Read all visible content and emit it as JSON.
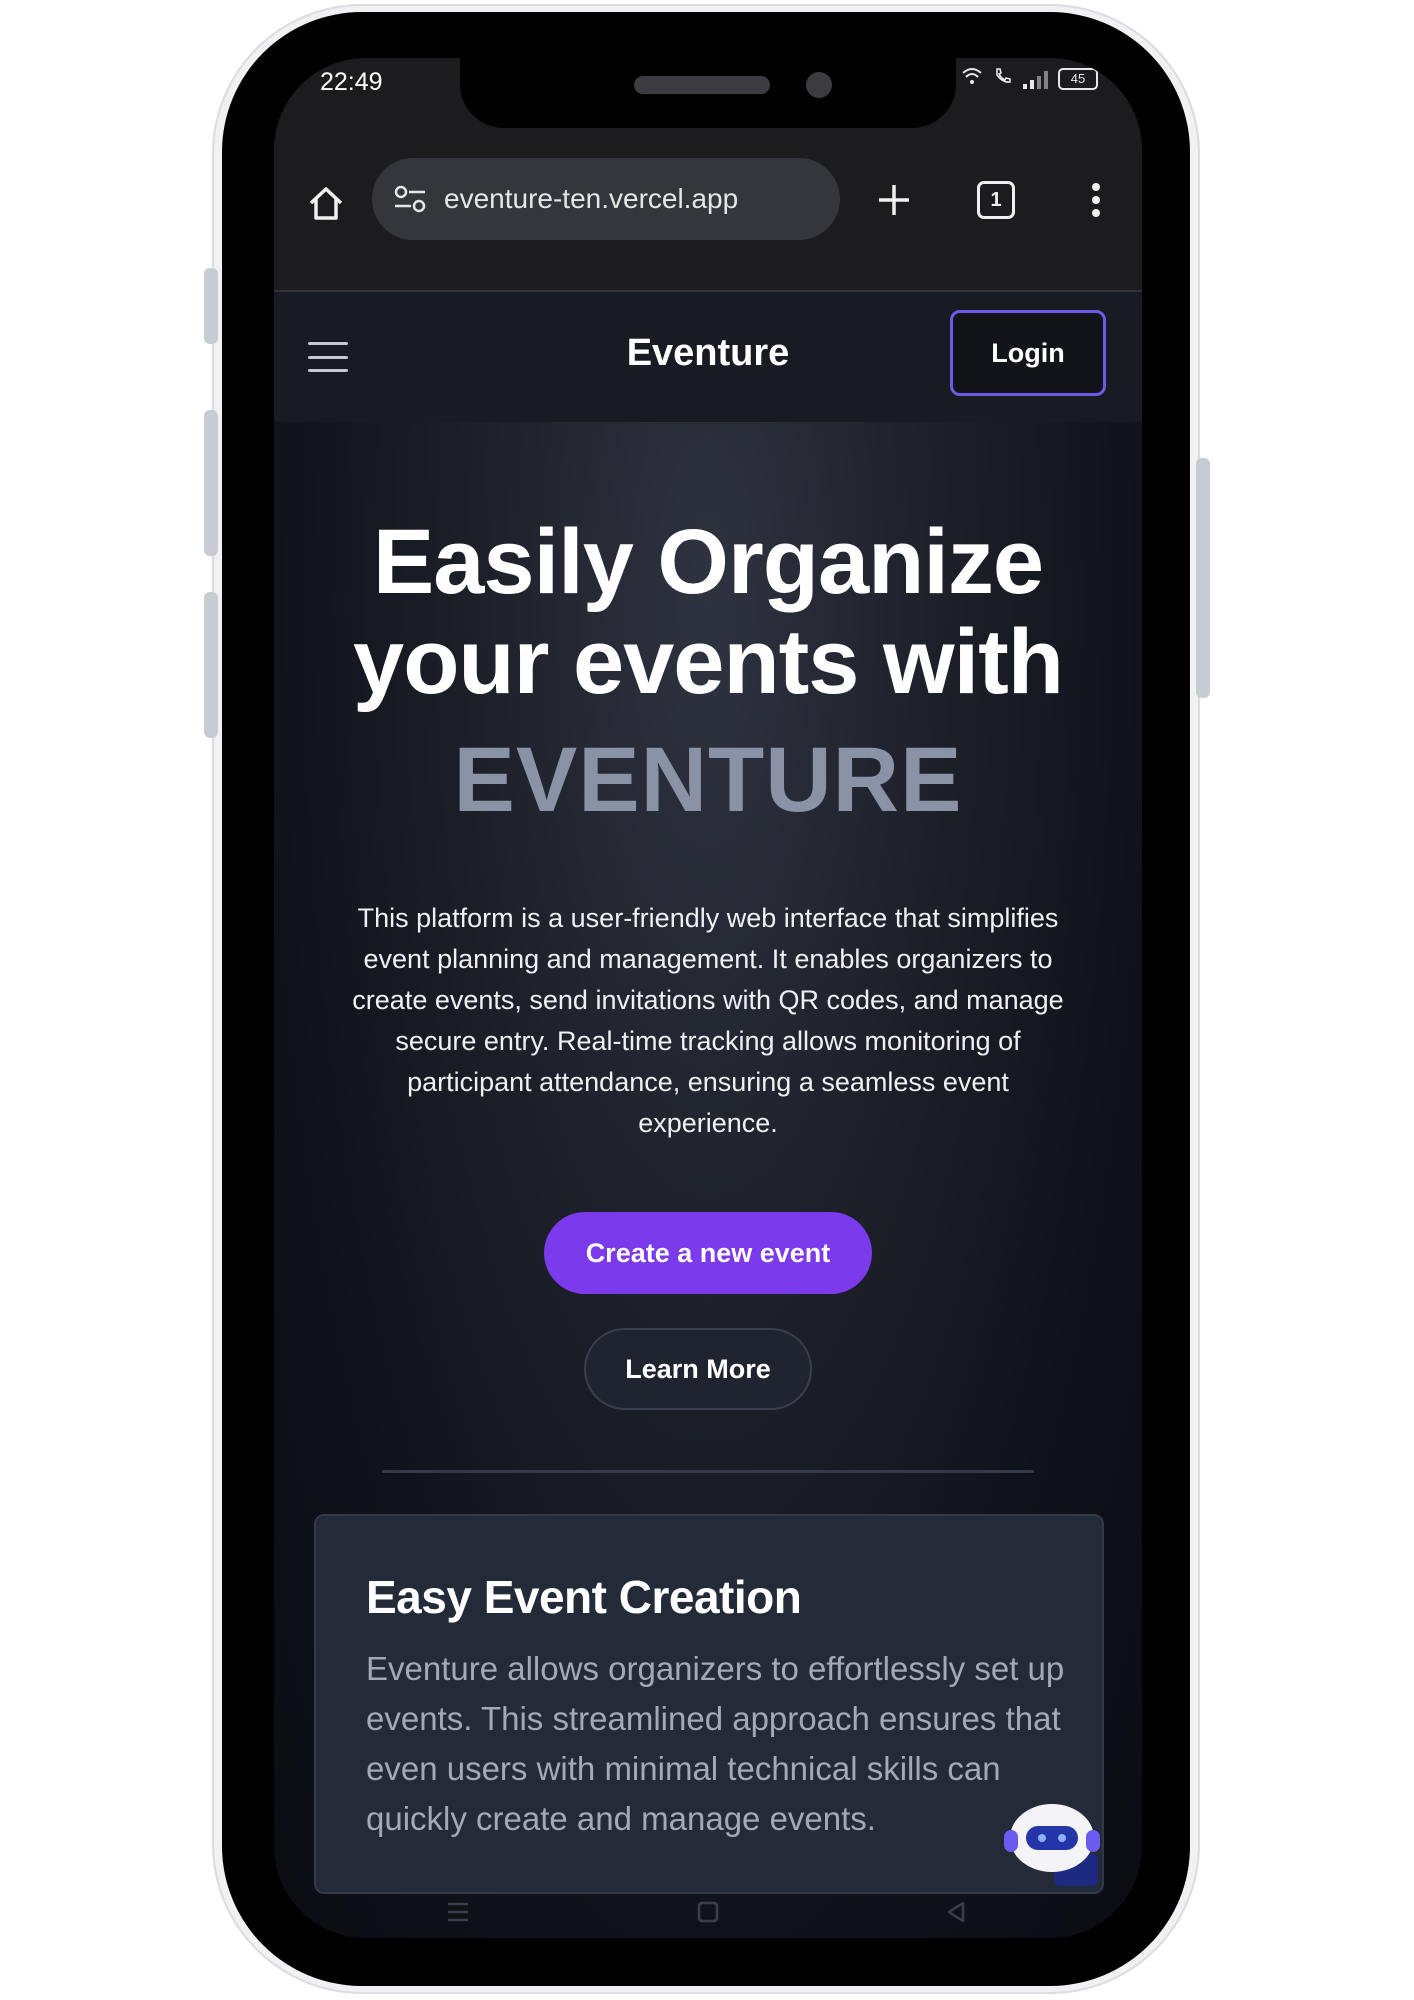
{
  "status_bar": {
    "time": "22:49",
    "battery": "45"
  },
  "browser": {
    "url": "eventure-ten.vercel.app",
    "tab_count": "1"
  },
  "site_nav": {
    "brand": "Eventure",
    "login_label": "Login"
  },
  "hero": {
    "title_line1": "Easily Organize",
    "title_line2": "your events with",
    "title_brand": "EVENTURE",
    "description": "This platform is a user-friendly web interface that simplifies event planning and management. It enables organizers to create events, send invitations with QR codes, and manage secure entry. Real-time tracking allows monitoring of participant attendance, ensuring a seamless event experience.",
    "primary_cta": "Create a new event",
    "secondary_cta": "Learn More"
  },
  "feature": {
    "title": "Easy Event Creation",
    "text": "Eventure allows organizers to effortlessly set up events. This streamlined approach ensures that even users with minimal technical skills can quickly create and manage events."
  },
  "colors": {
    "accent": "#7c3aed",
    "login_border": "#6c5ce7",
    "brand_gray": "#8a92a6",
    "card_bg": "#232a38"
  },
  "icons": {
    "browser": [
      "home-icon",
      "site-settings-icon",
      "new-tab-icon",
      "tab-switcher-icon",
      "overflow-menu-icon"
    ],
    "site": [
      "hamburger-menu-icon",
      "chatbot-icon"
    ],
    "android_nav": [
      "recents-icon",
      "home-nav-icon",
      "back-icon"
    ],
    "status": [
      "wifi-icon",
      "call-icon",
      "signal-icon",
      "battery-icon"
    ]
  }
}
